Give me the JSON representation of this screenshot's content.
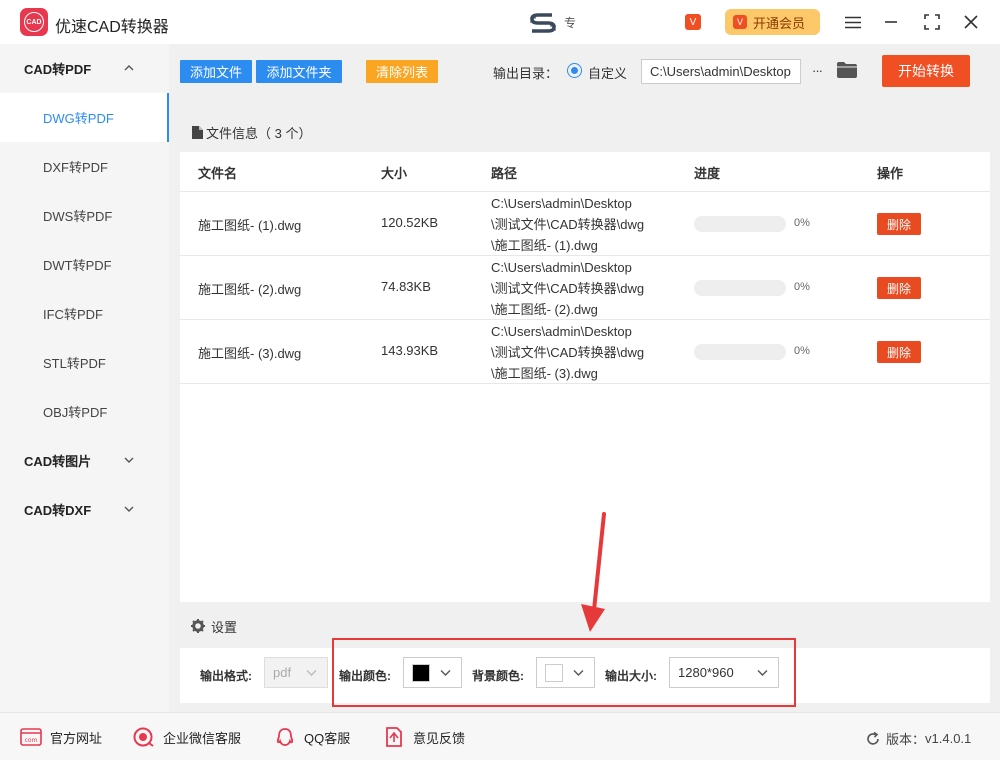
{
  "app": {
    "title": "优速CAD转换器",
    "logo_text": "CAD",
    "tray_text": "专"
  },
  "header": {
    "vip_small": "V",
    "vip_button": "开通会员",
    "vip_icon": "V"
  },
  "sidebar": {
    "groups": [
      {
        "label": "CAD转PDF",
        "expanded": true
      },
      {
        "label": "CAD转图片",
        "expanded": false
      },
      {
        "label": "CAD转DXF",
        "expanded": false
      }
    ],
    "items": [
      {
        "label": "DWG转PDF",
        "active": true
      },
      {
        "label": "DXF转PDF",
        "active": false
      },
      {
        "label": "DWS转PDF",
        "active": false
      },
      {
        "label": "DWT转PDF",
        "active": false
      },
      {
        "label": "IFC转PDF",
        "active": false
      },
      {
        "label": "STL转PDF",
        "active": false
      },
      {
        "label": "OBJ转PDF",
        "active": false
      }
    ]
  },
  "toolbar": {
    "add_file": "添加文件",
    "add_folder": "添加文件夹",
    "clear_list": "清除列表",
    "output_dir_label": "输出目录：",
    "custom_option": "自定义",
    "output_path": "C:\\Users\\admin\\Desktop",
    "more": "···",
    "start": "开始转换"
  },
  "files": {
    "header": "文件信息（ 3 个）",
    "columns": {
      "name": "文件名",
      "size": "大小",
      "path": "路径",
      "progress": "进度",
      "action": "操作"
    },
    "rows": [
      {
        "name": "施工图纸- (1).dwg",
        "size": "120.52KB",
        "path1": "C:\\Users\\admin\\Desktop",
        "path2": "\\测试文件\\CAD转换器\\dwg",
        "path3": "\\施工图纸- (1).dwg",
        "progress": 0,
        "percent": "0%",
        "delete": "删除"
      },
      {
        "name": "施工图纸- (2).dwg",
        "size": "74.83KB",
        "path1": "C:\\Users\\admin\\Desktop",
        "path2": "\\测试文件\\CAD转换器\\dwg",
        "path3": "\\施工图纸- (2).dwg",
        "progress": 0,
        "percent": "0%",
        "delete": "删除"
      },
      {
        "name": "施工图纸- (3).dwg",
        "size": "143.93KB",
        "path1": "C:\\Users\\admin\\Desktop",
        "path2": "\\测试文件\\CAD转换器\\dwg",
        "path3": "\\施工图纸- (3).dwg",
        "progress": 0,
        "percent": "0%",
        "delete": "删除"
      }
    ]
  },
  "settings": {
    "title": "设置",
    "format_label": "输出格式:",
    "format_value": "pdf",
    "color_label": "输出颜色:",
    "color_value": "#000000",
    "bg_label": "背景颜色:",
    "bg_value": "#ffffff",
    "size_label": "输出大小:",
    "size_value": "1280*960"
  },
  "footer": {
    "website": "官方网址",
    "website_icon_text": "com",
    "wechat": "企业微信客服",
    "qq": "QQ客服",
    "feedback": "意见反馈",
    "version_label": "版本：",
    "version": "v1.4.0.1"
  },
  "colors": {
    "accent": "#2d8cf0",
    "danger": "#f04e23",
    "warning": "#fba623",
    "highlight": "#e63a3a"
  }
}
